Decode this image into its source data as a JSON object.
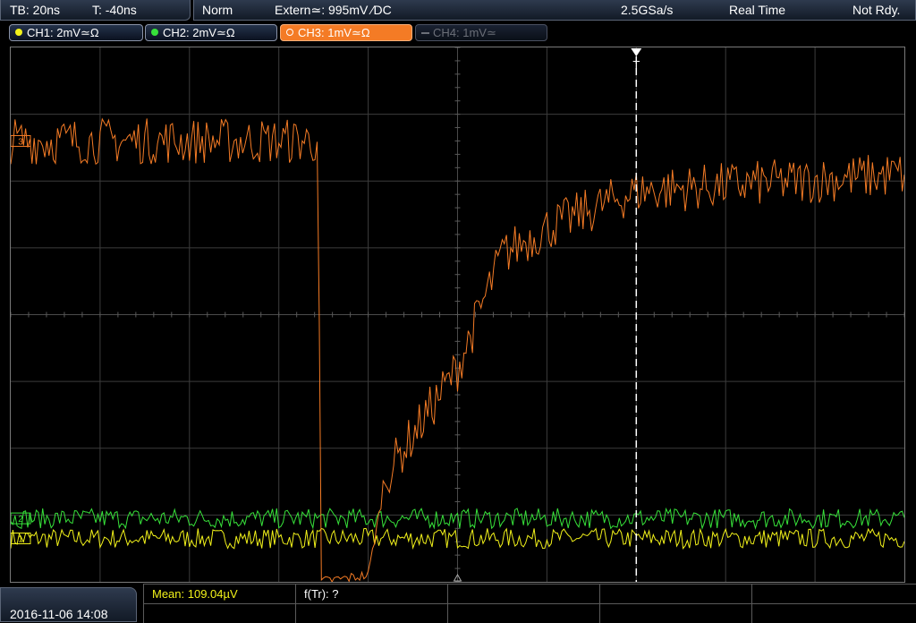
{
  "status": {
    "timebase": "TB: 20ns",
    "trigger_time": "T: -40ns",
    "mode": "Norm",
    "trigger_source": "Extern≃: 995mV ∕DC",
    "sample_rate": "2.5GSa/s",
    "acq_mode": "Real Time",
    "state": "Not Rdy."
  },
  "channels": [
    {
      "label": "CH1: 2mV≃Ω",
      "color": "#f2f21a",
      "active": false,
      "enabled": true
    },
    {
      "label": "CH2: 2mV≃Ω",
      "color": "#37e23a",
      "active": false,
      "enabled": true
    },
    {
      "label": "CH3: 1mV≃Ω",
      "color": "#f47b25",
      "active": true,
      "enabled": true
    },
    {
      "label": "CH4: 1mV≃",
      "color": "#6b6f78",
      "active": false,
      "enabled": false
    }
  ],
  "markers": {
    "trigger_marker": "T",
    "ch3_marker": "3",
    "ch2_marker": "2",
    "ch1_marker": "1"
  },
  "measurement": {
    "mean": "Mean: 109.04µV",
    "ftr": "f(Tr): ?"
  },
  "datetime": "2016-11-06 14:08",
  "colors": {
    "ch1": "#f2f21a",
    "ch2": "#37e23a",
    "ch3": "#f47b25",
    "grid": "#3c3c3c",
    "accent_bg": "#1b2538"
  },
  "chart_data": {
    "type": "line",
    "xlim_divisions": [
      0,
      10
    ],
    "ylim_divisions": [
      0,
      8
    ],
    "grid": true,
    "series": [
      {
        "name": "CH1",
        "baseline_div": 0.65,
        "noise_div": 0.15
      },
      {
        "name": "CH2",
        "baseline_div": 0.95,
        "noise_div": 0.15
      },
      {
        "name": "CH3",
        "segments": [
          {
            "x_div": 0.0,
            "y_div": 6.6
          },
          {
            "x_div": 3.44,
            "y_div": 6.6
          },
          {
            "x_div": 3.47,
            "y_div": 0.0
          },
          {
            "x_div": 4.0,
            "y_div": 0.1
          },
          {
            "x_div": 4.2,
            "y_div": 1.6
          },
          {
            "x_div": 5.0,
            "y_div": 3.2
          },
          {
            "x_div": 5.5,
            "y_div": 4.9
          },
          {
            "x_div": 6.0,
            "y_div": 5.3
          },
          {
            "x_div": 7.0,
            "y_div": 5.85
          },
          {
            "x_div": 10.0,
            "y_div": 6.1
          }
        ],
        "noise_div": 0.35
      }
    ],
    "trigger_position_div": 7.0
  }
}
